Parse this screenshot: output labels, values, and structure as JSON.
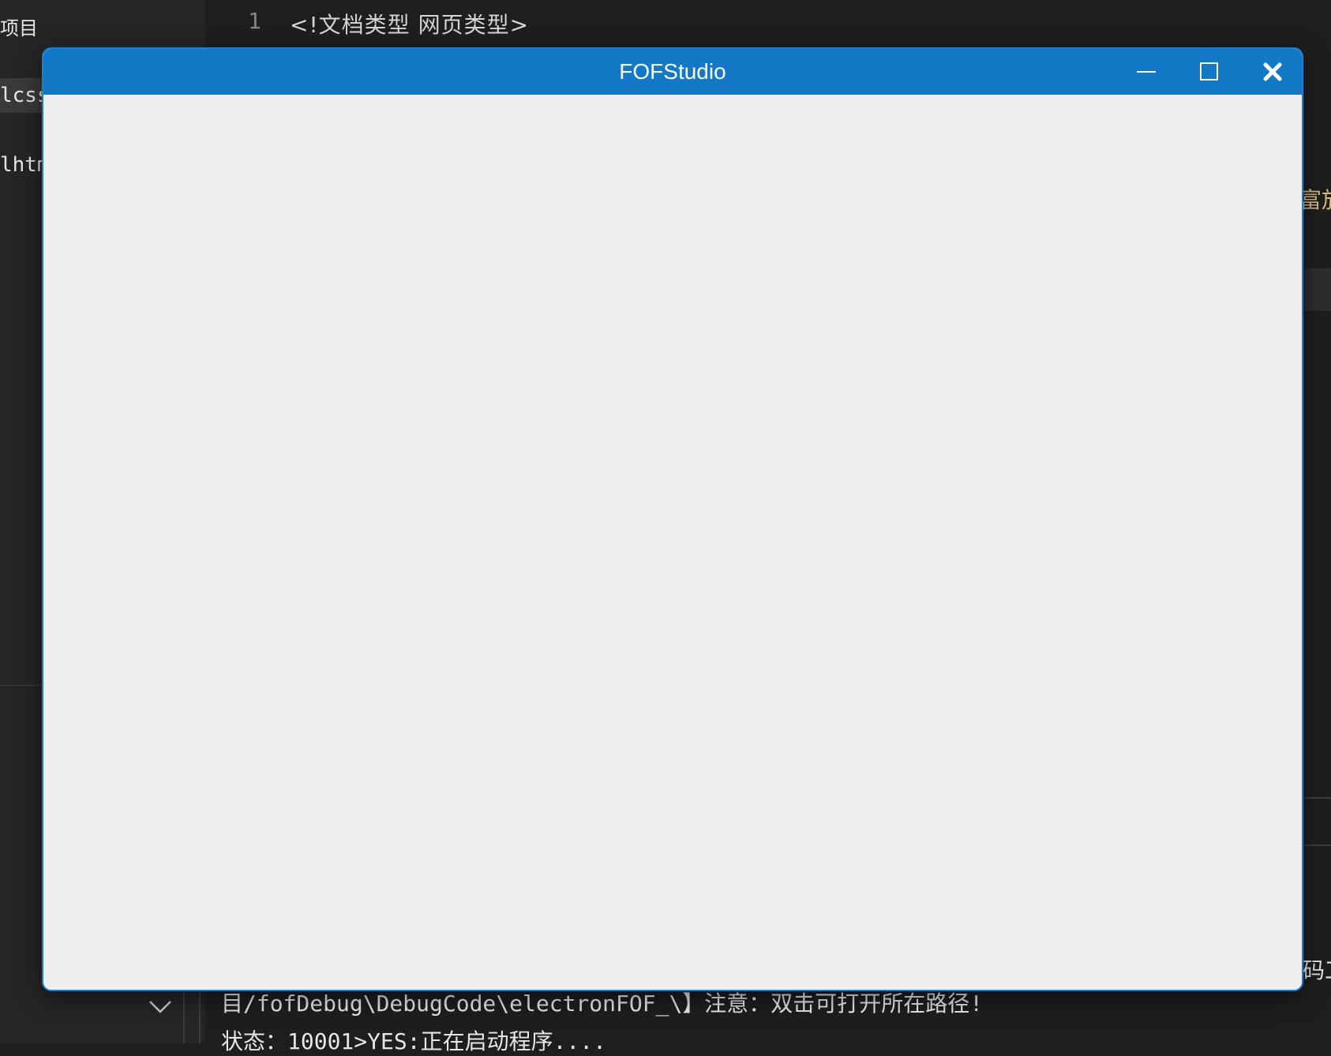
{
  "sidebar": {
    "title": "项目",
    "files": [
      {
        "label": "lcss"
      },
      {
        "label": "lhtm"
      }
    ]
  },
  "editor": {
    "line_number": "1",
    "line_code": "<!文档类型 网页类型>",
    "right_fragment": "富放",
    "right_fragment_2": "码工"
  },
  "terminal": {
    "line1": "目/fofDebug\\DebugCode\\electronFOF_\\】注意：双击可打开所在路径!",
    "line2": "状态：10001>YES:正在启动程序...."
  },
  "window": {
    "title": "FOFStudio",
    "titlebar_color": "#1379c6",
    "content_color": "#efefef"
  }
}
